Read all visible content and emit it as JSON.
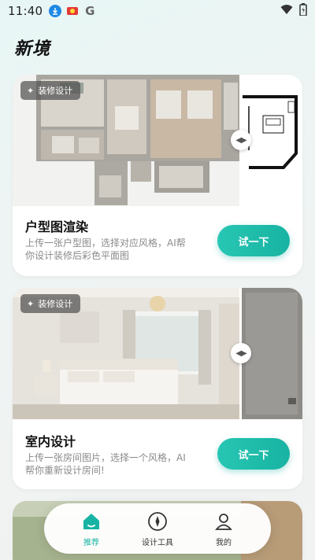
{
  "status_bar": {
    "time": "11:40",
    "left_icons": [
      "download-icon",
      "flag-icon",
      "google-icon"
    ],
    "right_icons": [
      "wifi-icon",
      "battery-icon"
    ]
  },
  "app": {
    "title": "新境"
  },
  "cards": [
    {
      "tag": "装修设计",
      "title": "户型图渲染",
      "description": "上传一张户型图，选择对应风格，AI帮你设计装修后彩色平面图",
      "button": "试一下"
    },
    {
      "tag": "装修设计",
      "title": "室内设计",
      "description": "上传一张房间图片，选择一个风格，AI帮你重新设计房间!",
      "button": "试一下"
    }
  ],
  "tabs": [
    {
      "label": "推荐",
      "icon": "home-icon",
      "active": true
    },
    {
      "label": "设计工具",
      "icon": "compass-icon",
      "active": false
    },
    {
      "label": "我的",
      "icon": "user-icon",
      "active": false
    }
  ],
  "colors": {
    "accent": "#18b3a2",
    "background": "#eef4f3"
  }
}
